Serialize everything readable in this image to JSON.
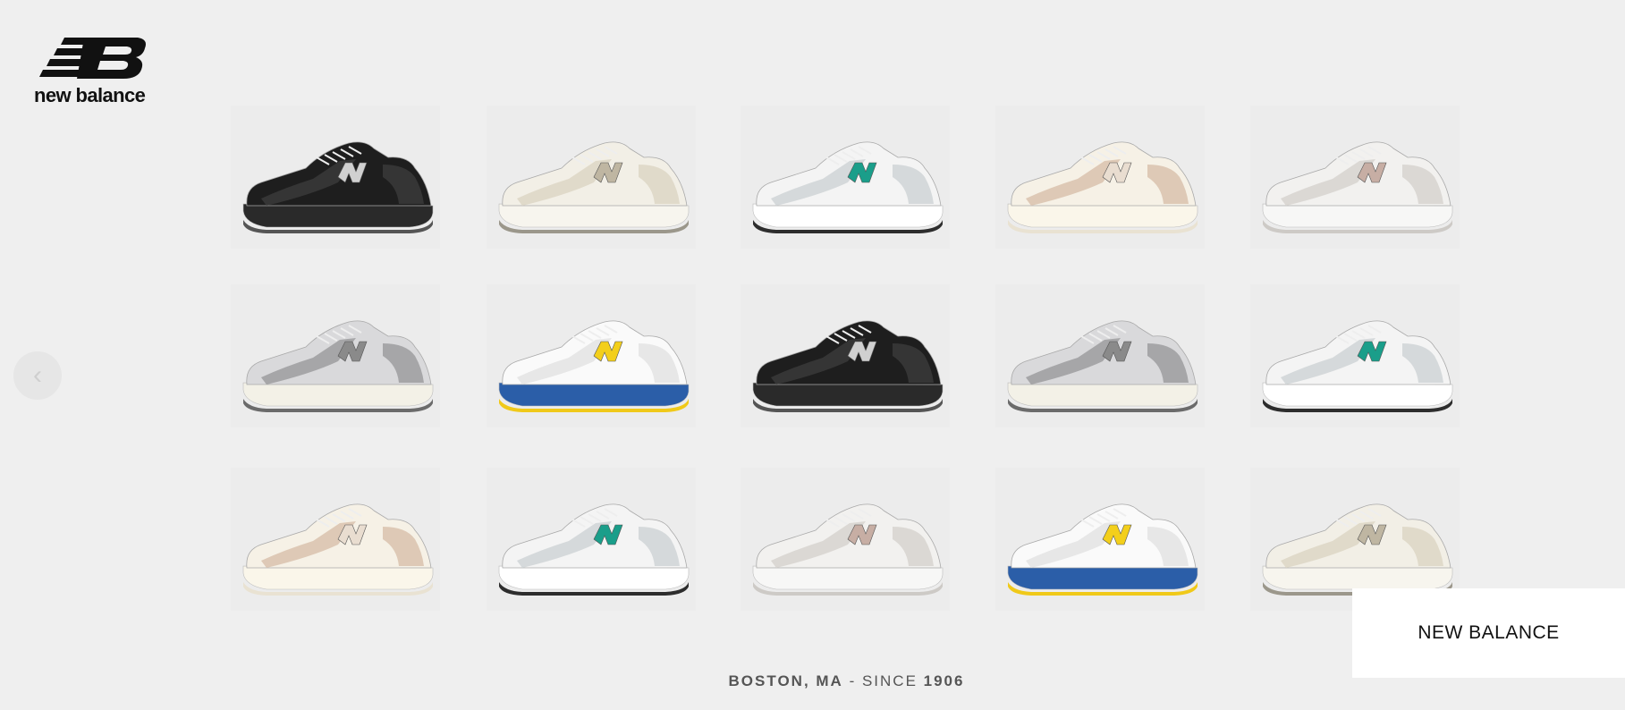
{
  "brand": {
    "logo_text": "new balance",
    "logo_icon": "nb-stripes-logo"
  },
  "carousel": {
    "prev_icon": "chevron-left-icon"
  },
  "products": [
    {
      "id": "r1c1",
      "shoe": "black",
      "accent": "#2b2b2b"
    },
    {
      "id": "r1c2",
      "shoe": "cream",
      "accent": "#cfc6b4"
    },
    {
      "id": "r1c3",
      "shoe": "white-teal",
      "accent": "#1a9e8a"
    },
    {
      "id": "r1c4",
      "shoe": "beige-327",
      "accent": "#d8c3b0"
    },
    {
      "id": "r1c5",
      "shoe": "light-grey",
      "accent": "#c7b9b2"
    },
    {
      "id": "r2c1",
      "shoe": "grey",
      "accent": "#9a9a9a"
    },
    {
      "id": "r2c2",
      "shoe": "white-yellow-blue",
      "accent": "#f3cf1b"
    },
    {
      "id": "r2c3",
      "shoe": "black",
      "accent": "#2b2b2b"
    },
    {
      "id": "r2c4",
      "shoe": "grey",
      "accent": "#9a9a9a"
    },
    {
      "id": "r2c5",
      "shoe": "white-teal",
      "accent": "#1a9e8a"
    },
    {
      "id": "r3c1",
      "shoe": "beige-327",
      "accent": "#d8c3b0"
    },
    {
      "id": "r3c2",
      "shoe": "white-teal",
      "accent": "#1a9e8a"
    },
    {
      "id": "r3c3",
      "shoe": "light-grey",
      "accent": "#c7b9b2"
    },
    {
      "id": "r3c4",
      "shoe": "white-yellow-blue",
      "accent": "#f3cf1b"
    },
    {
      "id": "r3c5",
      "shoe": "cream",
      "accent": "#cfc6b4"
    }
  ],
  "footer": {
    "location": "BOSTON, MA",
    "separator": " - ",
    "since_label": "SINCE ",
    "year": "1906"
  },
  "brand_box": {
    "label": "NEW BALANCE"
  },
  "colors": {
    "background": "#efefef",
    "tile": "#ececec",
    "brand_box": "#ffffff",
    "text": "#111111"
  }
}
